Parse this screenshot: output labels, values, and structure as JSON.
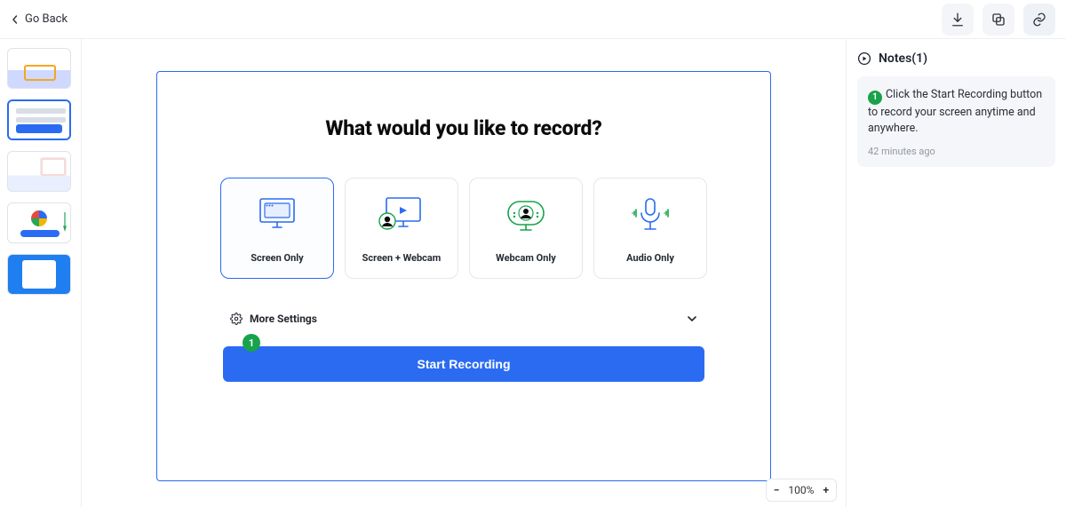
{
  "header": {
    "back_label": "Go Back"
  },
  "stage": {
    "title": "What would you like to record?",
    "options": [
      {
        "label": "Screen Only"
      },
      {
        "label": "Screen + Webcam"
      },
      {
        "label": "Webcam Only"
      },
      {
        "label": "Audio Only"
      }
    ],
    "more_settings_label": "More Settings",
    "step_badge": "1",
    "start_button_label": "Start Recording"
  },
  "zoom": {
    "level": "100%"
  },
  "notes": {
    "heading": "Notes(1)",
    "items": [
      {
        "badge": "1",
        "text": "Click the Start Recording button to record your screen anytime and anywhere.",
        "time": "42 minutes ago"
      }
    ]
  }
}
